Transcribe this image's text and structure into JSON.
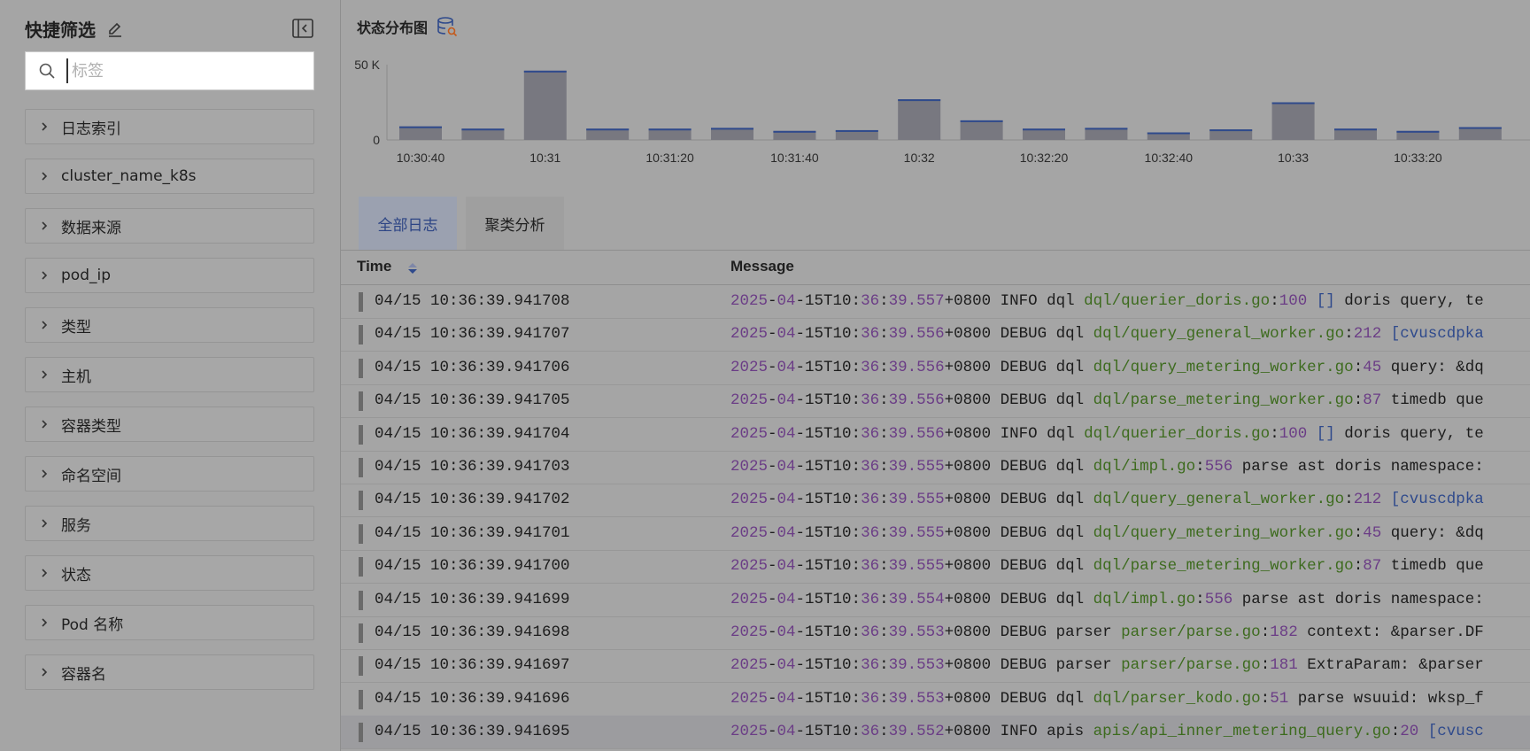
{
  "sidebar": {
    "title": "快捷筛选",
    "search_placeholder": "标签",
    "filters": [
      "日志索引",
      "cluster_name_k8s",
      "数据来源",
      "pod_ip",
      "类型",
      "主机",
      "容器类型",
      "命名空间",
      "服务",
      "状态",
      "Pod 名称",
      "容器名"
    ]
  },
  "main": {
    "chart_title": "状态分布图",
    "tabs": [
      "全部日志",
      "聚类分析"
    ],
    "columns": {
      "time": "Time",
      "message": "Message"
    }
  },
  "chart_data": {
    "type": "bar",
    "title": "状态分布图",
    "y_ticks": [
      "50 K",
      "0"
    ],
    "ylim": [
      0,
      50000
    ],
    "x_tick_labels": [
      "10:30:40",
      "10:31",
      "10:31:20",
      "10:31:40",
      "10:32",
      "10:32:20",
      "10:32:40",
      "10:33",
      "10:33:20"
    ],
    "categories": [
      "10:30:40",
      "10:30:50",
      "10:31",
      "10:31:10",
      "10:31:20",
      "10:31:30",
      "10:31:40",
      "10:31:50",
      "10:32",
      "10:32:10",
      "10:32:20",
      "10:32:30",
      "10:32:40",
      "10:32:50",
      "10:33",
      "10:33:10",
      "10:33:20",
      "10:33:30"
    ],
    "values": [
      9000,
      7500,
      46000,
      7500,
      7500,
      8000,
      6000,
      6500,
      27000,
      13000,
      7500,
      8000,
      5000,
      7000,
      25000,
      7500,
      6000,
      8500
    ],
    "colors": {
      "bar": "#787880",
      "top": "#2f4a8c"
    }
  },
  "rows": [
    {
      "time": "04/15 10:36:39.941708",
      "msg": [
        [
          "c-num",
          "2025"
        ],
        [
          "",
          "-"
        ],
        [
          "c-num",
          "04"
        ],
        [
          "",
          "-15T10:"
        ],
        [
          "c-num",
          "36"
        ],
        [
          "",
          ":"
        ],
        [
          "c-num",
          "39.557"
        ],
        [
          "",
          "+0800 INFO dql "
        ],
        [
          "c-path",
          "dql/querier_doris.go"
        ],
        [
          "",
          ":"
        ],
        [
          "c-num",
          "100"
        ],
        [
          "c-br",
          " []"
        ],
        [
          "",
          " doris query, te"
        ]
      ]
    },
    {
      "time": "04/15 10:36:39.941707",
      "msg": [
        [
          "c-num",
          "2025"
        ],
        [
          "",
          "-"
        ],
        [
          "c-num",
          "04"
        ],
        [
          "",
          "-15T10:"
        ],
        [
          "c-num",
          "36"
        ],
        [
          "",
          ":"
        ],
        [
          "c-num",
          "39.556"
        ],
        [
          "",
          "+0800 DEBUG dql "
        ],
        [
          "c-path",
          "dql/query_general_worker.go"
        ],
        [
          "",
          ":"
        ],
        [
          "c-num",
          "212"
        ],
        [
          "c-br",
          " [cvuscdpka"
        ]
      ]
    },
    {
      "time": "04/15 10:36:39.941706",
      "msg": [
        [
          "c-num",
          "2025"
        ],
        [
          "",
          "-"
        ],
        [
          "c-num",
          "04"
        ],
        [
          "",
          "-15T10:"
        ],
        [
          "c-num",
          "36"
        ],
        [
          "",
          ":"
        ],
        [
          "c-num",
          "39.556"
        ],
        [
          "",
          "+0800 DEBUG dql "
        ],
        [
          "c-path",
          "dql/query_metering_worker.go"
        ],
        [
          "",
          ":"
        ],
        [
          "c-num",
          "45"
        ],
        [
          "",
          " query: &dq"
        ]
      ]
    },
    {
      "time": "04/15 10:36:39.941705",
      "msg": [
        [
          "c-num",
          "2025"
        ],
        [
          "",
          "-"
        ],
        [
          "c-num",
          "04"
        ],
        [
          "",
          "-15T10:"
        ],
        [
          "c-num",
          "36"
        ],
        [
          "",
          ":"
        ],
        [
          "c-num",
          "39.556"
        ],
        [
          "",
          "+0800 DEBUG dql "
        ],
        [
          "c-path",
          "dql/parse_metering_worker.go"
        ],
        [
          "",
          ":"
        ],
        [
          "c-num",
          "87"
        ],
        [
          "",
          " timedb que"
        ]
      ]
    },
    {
      "time": "04/15 10:36:39.941704",
      "msg": [
        [
          "c-num",
          "2025"
        ],
        [
          "",
          "-"
        ],
        [
          "c-num",
          "04"
        ],
        [
          "",
          "-15T10:"
        ],
        [
          "c-num",
          "36"
        ],
        [
          "",
          ":"
        ],
        [
          "c-num",
          "39.556"
        ],
        [
          "",
          "+0800 INFO dql "
        ],
        [
          "c-path",
          "dql/querier_doris.go"
        ],
        [
          "",
          ":"
        ],
        [
          "c-num",
          "100"
        ],
        [
          "c-br",
          " []"
        ],
        [
          "",
          " doris query, te"
        ]
      ]
    },
    {
      "time": "04/15 10:36:39.941703",
      "msg": [
        [
          "c-num",
          "2025"
        ],
        [
          "",
          "-"
        ],
        [
          "c-num",
          "04"
        ],
        [
          "",
          "-15T10:"
        ],
        [
          "c-num",
          "36"
        ],
        [
          "",
          ":"
        ],
        [
          "c-num",
          "39.555"
        ],
        [
          "",
          "+0800 DEBUG dql "
        ],
        [
          "c-path",
          "dql/impl.go"
        ],
        [
          "",
          ":"
        ],
        [
          "c-num",
          "556"
        ],
        [
          "",
          " parse ast doris namespace:"
        ]
      ]
    },
    {
      "time": "04/15 10:36:39.941702",
      "msg": [
        [
          "c-num",
          "2025"
        ],
        [
          "",
          "-"
        ],
        [
          "c-num",
          "04"
        ],
        [
          "",
          "-15T10:"
        ],
        [
          "c-num",
          "36"
        ],
        [
          "",
          ":"
        ],
        [
          "c-num",
          "39.555"
        ],
        [
          "",
          "+0800 DEBUG dql "
        ],
        [
          "c-path",
          "dql/query_general_worker.go"
        ],
        [
          "",
          ":"
        ],
        [
          "c-num",
          "212"
        ],
        [
          "c-br",
          " [cvuscdpka"
        ]
      ]
    },
    {
      "time": "04/15 10:36:39.941701",
      "msg": [
        [
          "c-num",
          "2025"
        ],
        [
          "",
          "-"
        ],
        [
          "c-num",
          "04"
        ],
        [
          "",
          "-15T10:"
        ],
        [
          "c-num",
          "36"
        ],
        [
          "",
          ":"
        ],
        [
          "c-num",
          "39.555"
        ],
        [
          "",
          "+0800 DEBUG dql "
        ],
        [
          "c-path",
          "dql/query_metering_worker.go"
        ],
        [
          "",
          ":"
        ],
        [
          "c-num",
          "45"
        ],
        [
          "",
          " query: &dq"
        ]
      ]
    },
    {
      "time": "04/15 10:36:39.941700",
      "msg": [
        [
          "c-num",
          "2025"
        ],
        [
          "",
          "-"
        ],
        [
          "c-num",
          "04"
        ],
        [
          "",
          "-15T10:"
        ],
        [
          "c-num",
          "36"
        ],
        [
          "",
          ":"
        ],
        [
          "c-num",
          "39.555"
        ],
        [
          "",
          "+0800 DEBUG dql "
        ],
        [
          "c-path",
          "dql/parse_metering_worker.go"
        ],
        [
          "",
          ":"
        ],
        [
          "c-num",
          "87"
        ],
        [
          "",
          " timedb que"
        ]
      ]
    },
    {
      "time": "04/15 10:36:39.941699",
      "msg": [
        [
          "c-num",
          "2025"
        ],
        [
          "",
          "-"
        ],
        [
          "c-num",
          "04"
        ],
        [
          "",
          "-15T10:"
        ],
        [
          "c-num",
          "36"
        ],
        [
          "",
          ":"
        ],
        [
          "c-num",
          "39.554"
        ],
        [
          "",
          "+0800 DEBUG dql "
        ],
        [
          "c-path",
          "dql/impl.go"
        ],
        [
          "",
          ":"
        ],
        [
          "c-num",
          "556"
        ],
        [
          "",
          " parse ast doris namespace:"
        ]
      ]
    },
    {
      "time": "04/15 10:36:39.941698",
      "msg": [
        [
          "c-num",
          "2025"
        ],
        [
          "",
          "-"
        ],
        [
          "c-num",
          "04"
        ],
        [
          "",
          "-15T10:"
        ],
        [
          "c-num",
          "36"
        ],
        [
          "",
          ":"
        ],
        [
          "c-num",
          "39.553"
        ],
        [
          "",
          "+0800 DEBUG parser "
        ],
        [
          "c-path",
          "parser/parse.go"
        ],
        [
          "",
          ":"
        ],
        [
          "c-num",
          "182"
        ],
        [
          "",
          " context: &parser.DF"
        ]
      ]
    },
    {
      "time": "04/15 10:36:39.941697",
      "msg": [
        [
          "c-num",
          "2025"
        ],
        [
          "",
          "-"
        ],
        [
          "c-num",
          "04"
        ],
        [
          "",
          "-15T10:"
        ],
        [
          "c-num",
          "36"
        ],
        [
          "",
          ":"
        ],
        [
          "c-num",
          "39.553"
        ],
        [
          "",
          "+0800 DEBUG parser "
        ],
        [
          "c-path",
          "parser/parse.go"
        ],
        [
          "",
          ":"
        ],
        [
          "c-num",
          "181"
        ],
        [
          "",
          " ExtraParam: &parser"
        ]
      ]
    },
    {
      "time": "04/15 10:36:39.941696",
      "msg": [
        [
          "c-num",
          "2025"
        ],
        [
          "",
          "-"
        ],
        [
          "c-num",
          "04"
        ],
        [
          "",
          "-15T10:"
        ],
        [
          "c-num",
          "36"
        ],
        [
          "",
          ":"
        ],
        [
          "c-num",
          "39.553"
        ],
        [
          "",
          "+0800 DEBUG dql "
        ],
        [
          "c-path",
          "dql/parser_kodo.go"
        ],
        [
          "",
          ":"
        ],
        [
          "c-num",
          "51"
        ],
        [
          "",
          " parse wsuuid: wksp_f"
        ]
      ]
    },
    {
      "time": "04/15 10:36:39.941695",
      "msg": [
        [
          "c-num",
          "2025"
        ],
        [
          "",
          "-"
        ],
        [
          "c-num",
          "04"
        ],
        [
          "",
          "-15T10:"
        ],
        [
          "c-num",
          "36"
        ],
        [
          "",
          ":"
        ],
        [
          "c-num",
          "39.552"
        ],
        [
          "",
          "+0800 INFO apis "
        ],
        [
          "c-path",
          "apis/api_inner_metering_query.go"
        ],
        [
          "",
          ":"
        ],
        [
          "c-num",
          "20"
        ],
        [
          "c-br",
          " [cvusc"
        ]
      ]
    }
  ]
}
